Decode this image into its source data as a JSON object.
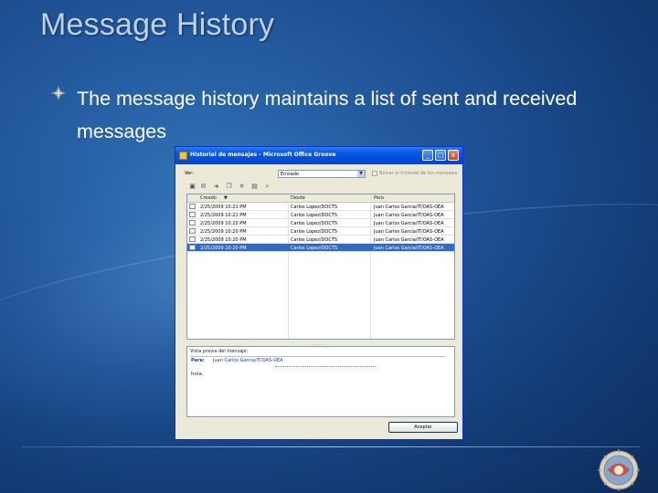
{
  "slide": {
    "title": "Message History",
    "bullet": "The message history maintains a list of sent and received messages"
  },
  "window": {
    "title": "Historial de mensajes - Microsoft Office Groove",
    "controls": {
      "minimize": "_",
      "maximize": "□",
      "close": "x"
    },
    "view_label": "Ver:",
    "view_select": "Enviado",
    "clear_history_label": "Borrar el historial de los mensajes",
    "toolbar_icons": [
      "open-icon",
      "reply-icon",
      "forward-icon",
      "copy-icon",
      "delete-icon",
      "print-icon",
      "find-icon"
    ],
    "columns": [
      "Creado",
      "Desde",
      "Para"
    ],
    "rows": [
      {
        "date": "2/25/2009 10:21 PM",
        "from": "Carlos Lopez/DOCTS",
        "to": "Juan Carlos Garcia/IT/OAS-OEA"
      },
      {
        "date": "2/25/2009 10:21 PM",
        "from": "Carlos Lopez/DOCTS",
        "to": "Juan Carlos Garcia/IT/OAS-OEA"
      },
      {
        "date": "2/25/2009 10:20 PM",
        "from": "Carlos Lopez/DOCTS",
        "to": "Juan Carlos Garcia/IT/OAS-OEA"
      },
      {
        "date": "2/25/2009 10:20 PM",
        "from": "Carlos Lopez/DOCTS",
        "to": "Juan Carlos Garcia/IT/OAS-OEA"
      },
      {
        "date": "2/25/2009 10:20 PM",
        "from": "Carlos Lopez/DOCTS",
        "to": "Juan Carlos Garcia/IT/OAS-OEA"
      },
      {
        "date": "2/25/2009 10:20 PM",
        "from": "Carlos Lopez/DOCTS",
        "to": "Juan Carlos Garcia/IT/OAS-OEA"
      }
    ],
    "selected_row": 5,
    "splitter": ". . . .",
    "preview_heading": "Vista previa del mensaje:",
    "preview_to_label": "Para:",
    "preview_to_value": "Juan Carlos Garcia/IT/OAS-OEA",
    "preview_body": "hola.",
    "ok_button": "Aceptar"
  },
  "colors": {
    "background": "#1d4f92",
    "title_text": "#bcd2ea",
    "bullet_text": "#ffffff",
    "titlebar": "#0a5ce4",
    "selection": "#316ac5"
  }
}
